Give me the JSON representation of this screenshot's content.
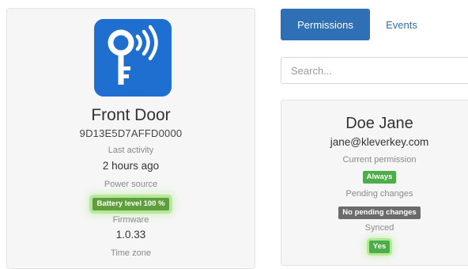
{
  "device": {
    "name": "Front Door",
    "id": "9D13E5D7AFFD0000",
    "last_activity_label": "Last activity",
    "last_activity_value": "2 hours ago",
    "power_source_label": "Power source",
    "battery_badge": "Battery level 100 %",
    "firmware_label": "Firmware",
    "firmware_value": "1.0.33",
    "time_zone_label": "Time zone",
    "icon": "wireless-key-icon",
    "icon_bg_color": "#1f6fd1"
  },
  "tabs": [
    {
      "label": "Permissions",
      "active": true
    },
    {
      "label": "Events",
      "active": false
    }
  ],
  "search": {
    "placeholder": "Search..."
  },
  "user": {
    "name": "Doe Jane",
    "email": "jane@kleverkey.com",
    "current_permission_label": "Current permission",
    "current_permission_badge": "Always",
    "pending_changes_label": "Pending changes",
    "pending_changes_badge": "No pending changes",
    "synced_label": "Synced",
    "synced_badge": "Yes"
  },
  "colors": {
    "accent": "#2e6fb6",
    "success": "#4dad48",
    "neutral_badge": "#6b6b6b"
  }
}
